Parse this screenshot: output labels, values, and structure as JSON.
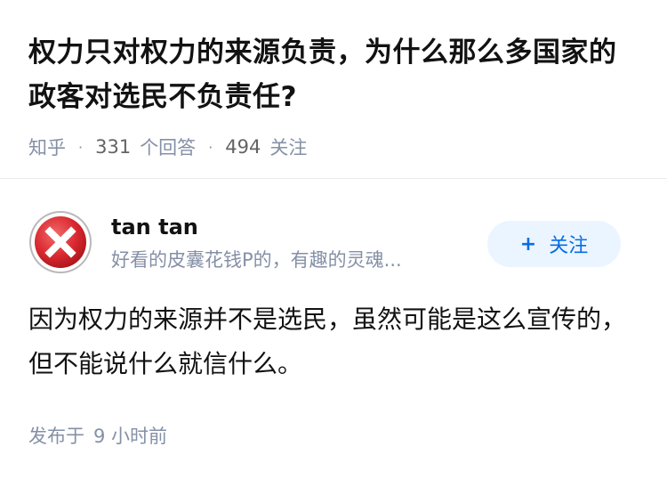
{
  "question": {
    "title": "权力只对权力的来源负责，为什么那么多国家的政客对选民不负责任?",
    "source": "知乎",
    "answer_count": "331",
    "answer_label": "个回答",
    "follower_count": "494",
    "follower_label": "关注"
  },
  "answer": {
    "author": {
      "name": "tan tan",
      "bio": "好看的皮囊花钱P的，有趣的灵魂...",
      "avatar_icon": "error-x-icon"
    },
    "follow_button": {
      "plus": "+",
      "label": "关注"
    },
    "content": "因为权力的来源并不是选民，虽然可能是这么宣传的，但不能说什么就信什么。",
    "time_prefix": "发布于",
    "time_value": "9 小时前"
  },
  "colors": {
    "title": "#121212",
    "meta": "#8590a6",
    "accent": "#056de8",
    "follow_bg": "#ebf5ff",
    "avatar_red": "#d9282f"
  }
}
